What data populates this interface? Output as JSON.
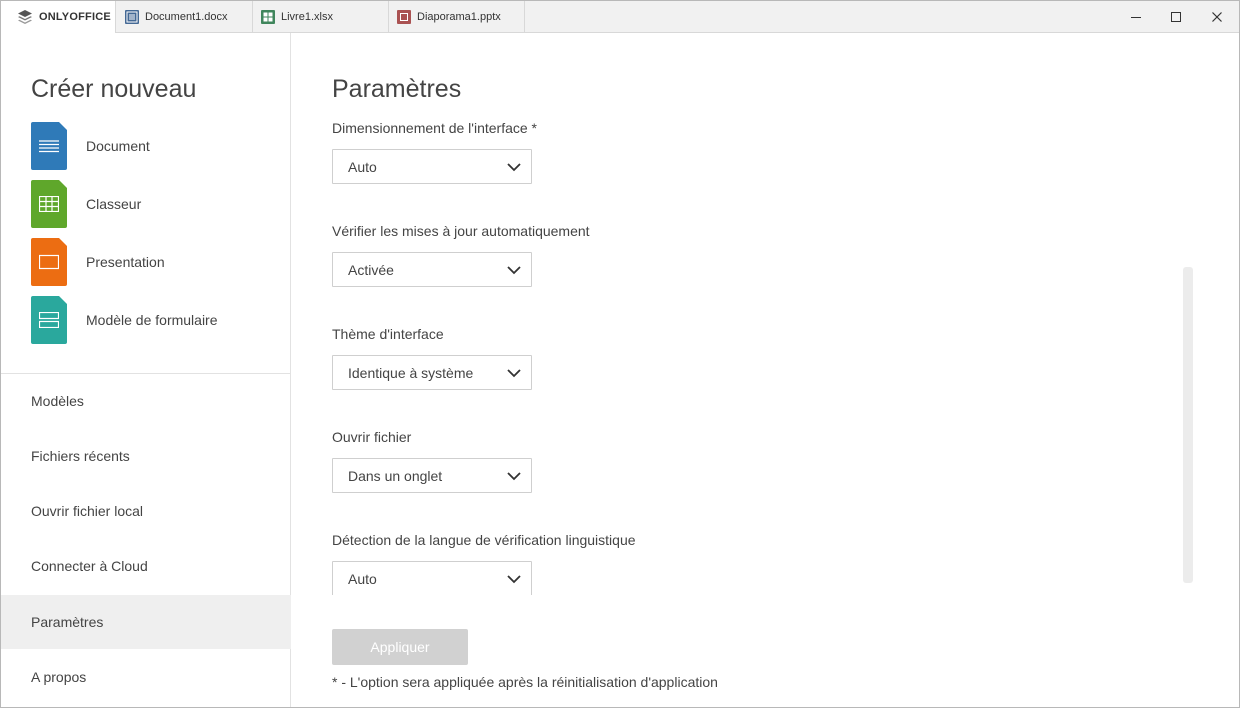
{
  "titlebar": {
    "app_name": "ONLYOFFICE",
    "tabs": [
      {
        "label": "Document1.docx",
        "color": "#446995"
      },
      {
        "label": "Livre1.xlsx",
        "color": "#40865c"
      },
      {
        "label": "Diaporama1.pptx",
        "color": "#aa5252"
      }
    ],
    "controls": {
      "minimize": "—",
      "maximize": "☐",
      "close": "✕"
    }
  },
  "sidebar": {
    "create_title": "Créer nouveau",
    "create_items": [
      {
        "label": "Document",
        "color": "#2f7ab8",
        "icon": "document-icon"
      },
      {
        "label": "Classeur",
        "color": "#5fa72b",
        "icon": "spreadsheet-icon"
      },
      {
        "label": "Presentation",
        "color": "#ec6d12",
        "icon": "presentation-icon"
      },
      {
        "label": "Modèle de formulaire",
        "color": "#2aa89d",
        "icon": "form-template-icon"
      }
    ],
    "nav": [
      {
        "label": "Modèles"
      },
      {
        "label": "Fichiers récents"
      },
      {
        "label": "Ouvrir fichier local"
      },
      {
        "label": "Connecter à Cloud"
      },
      {
        "label": "Paramètres",
        "active": true
      },
      {
        "label": "A propos"
      }
    ]
  },
  "main": {
    "title": "Paramètres",
    "settings": [
      {
        "label": "Dimensionnement de l'interface *",
        "value": "Auto"
      },
      {
        "label": "Vérifier les mises à jour automatiquement",
        "value": "Activée"
      },
      {
        "label": "Thème d'interface",
        "value": "Identique à système"
      },
      {
        "label": "Ouvrir fichier",
        "value": "Dans un onglet"
      },
      {
        "label": "Détection de la langue de vérification linguistique",
        "value": "Auto"
      }
    ],
    "apply_label": "Appliquer",
    "note": "* - L'option sera appliquée après la réinitialisation d'application"
  }
}
